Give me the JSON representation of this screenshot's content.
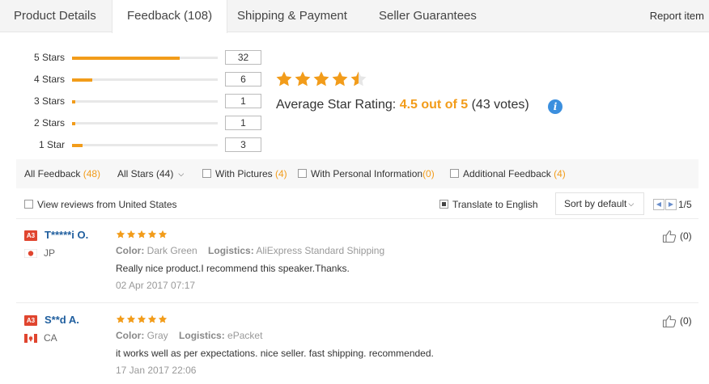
{
  "tabs": [
    {
      "label": "Product Details"
    },
    {
      "label": "Feedback (108)"
    },
    {
      "label": "Shipping & Payment"
    },
    {
      "label": "Seller Guarantees"
    }
  ],
  "report_label": "Report item",
  "histogram": [
    {
      "label": "5 Stars",
      "count": "32",
      "fraction": 0.74
    },
    {
      "label": "4 Stars",
      "count": "6",
      "fraction": 0.14
    },
    {
      "label": "3 Stars",
      "count": "1",
      "fraction": 0.02
    },
    {
      "label": "2 Stars",
      "count": "1",
      "fraction": 0.02
    },
    {
      "label": "1 Star",
      "count": "3",
      "fraction": 0.07
    }
  ],
  "rating": {
    "stars_value": 4.5,
    "prefix": "Average Star Rating: ",
    "score": "4.5 out of 5",
    "votes": " (43 votes)"
  },
  "filters": {
    "all_feedback": {
      "label": "All Feedback ",
      "count": "(48)"
    },
    "all_stars": "All Stars (44)",
    "with_pictures": {
      "label": "With Pictures ",
      "count": "(4)"
    },
    "personal_info": {
      "label": "With Personal Information",
      "count": "(0)"
    },
    "additional": {
      "label": "Additional Feedback ",
      "count": "(4)"
    }
  },
  "subbar": {
    "view_us": "View reviews from United States",
    "translate": "Translate to English",
    "translate_checked": true,
    "sort": "Sort by default",
    "page": "1/5"
  },
  "reviews": [
    {
      "badge": "A3",
      "name": "T*****i O.",
      "country": "JP",
      "stars": 5,
      "color_label": "Color:",
      "color": "Dark Green",
      "logistics_label": "Logistics:",
      "logistics": "AliExpress Standard Shipping",
      "text": "Really nice product.I recommend this speaker.Thanks.",
      "date": "02 Apr 2017 07:17",
      "helpful": "(0)"
    },
    {
      "badge": "A3",
      "name": "S**d A.",
      "country": "CA",
      "stars": 5,
      "color_label": "Color:",
      "color": "Gray",
      "logistics_label": "Logistics:",
      "logistics": "ePacket",
      "text": "it works well as per expectations. nice seller. fast shipping. recommended.",
      "date": "17 Jan 2017 22:06",
      "helpful": "(0)"
    }
  ],
  "colors": {
    "accent": "#f29c1a",
    "link": "#1f5e9e",
    "badge": "#e0452f",
    "info": "#3b8fde"
  }
}
